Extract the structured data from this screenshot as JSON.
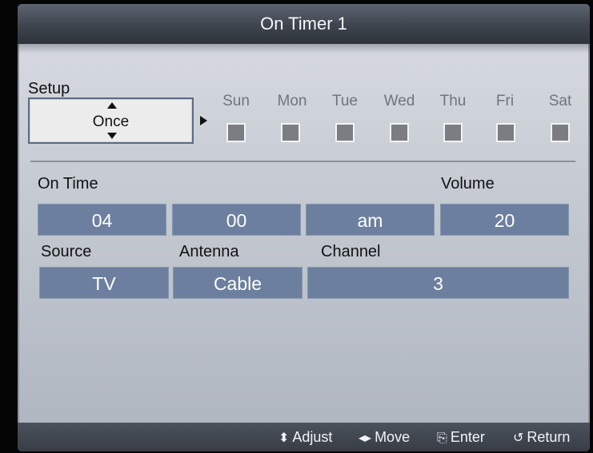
{
  "title": "On Timer 1",
  "setup": {
    "label": "Setup",
    "value": "Once"
  },
  "days": [
    {
      "label": "Sun",
      "checked": false
    },
    {
      "label": "Mon",
      "checked": false
    },
    {
      "label": "Tue",
      "checked": false
    },
    {
      "label": "Wed",
      "checked": false
    },
    {
      "label": "Thu",
      "checked": false
    },
    {
      "label": "Fri",
      "checked": false
    },
    {
      "label": "Sat",
      "checked": false
    }
  ],
  "on_time": {
    "label": "On Time",
    "hour": "04",
    "minute": "00",
    "ampm": "am"
  },
  "volume": {
    "label": "Volume",
    "value": "20"
  },
  "source": {
    "label": "Source",
    "value": "TV"
  },
  "antenna": {
    "label": "Antenna",
    "value": "Cable"
  },
  "channel": {
    "label": "Channel",
    "value": "3"
  },
  "footer": {
    "adjust": {
      "icon": "up-down-arrow-icon",
      "label": "Adjust"
    },
    "move": {
      "icon": "left-right-arrow-icon",
      "label": "Move"
    },
    "enter": {
      "icon": "enter-icon",
      "label": "Enter"
    },
    "return": {
      "icon": "return-icon",
      "label": "Return"
    }
  },
  "colors": {
    "field": "#6c7f9e",
    "title_bar": "#3e444d",
    "panel": "#c4c9d1",
    "checkbox": "#7b7d82"
  }
}
